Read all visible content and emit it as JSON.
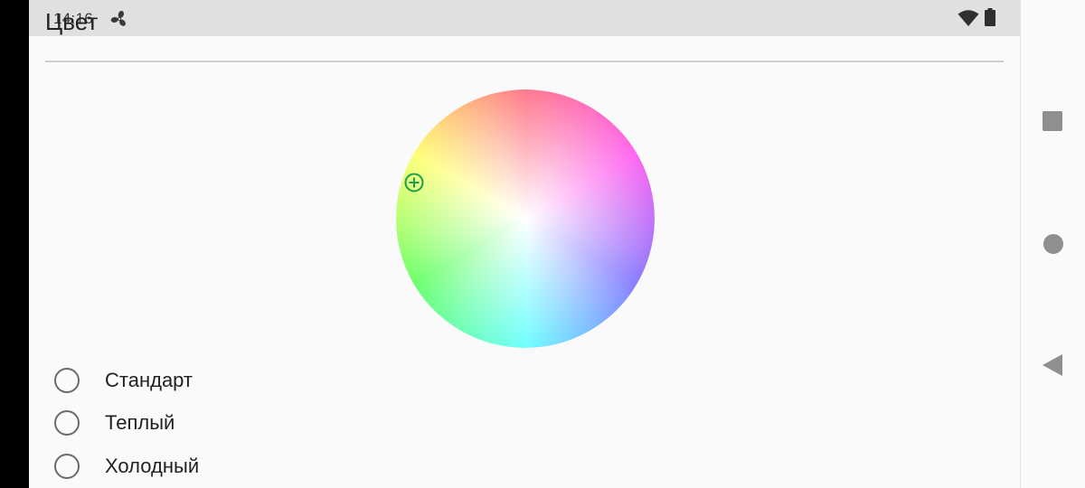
{
  "status_bar": {
    "time": "14:16",
    "icons": [
      "fan-icon",
      "wifi-icon",
      "battery-icon"
    ]
  },
  "section": {
    "title": "Цвет"
  },
  "color_wheel": {
    "marker_icon": "crosshair-plus-icon",
    "marker_color": "#1b9e4b"
  },
  "color_modes": {
    "options": [
      {
        "label": "Стандарт",
        "selected": false
      },
      {
        "label": "Теплый",
        "selected": false
      },
      {
        "label": "Холодный",
        "selected": false
      }
    ]
  },
  "navigation": {
    "buttons": [
      "recents-button",
      "home-button",
      "back-button"
    ]
  }
}
